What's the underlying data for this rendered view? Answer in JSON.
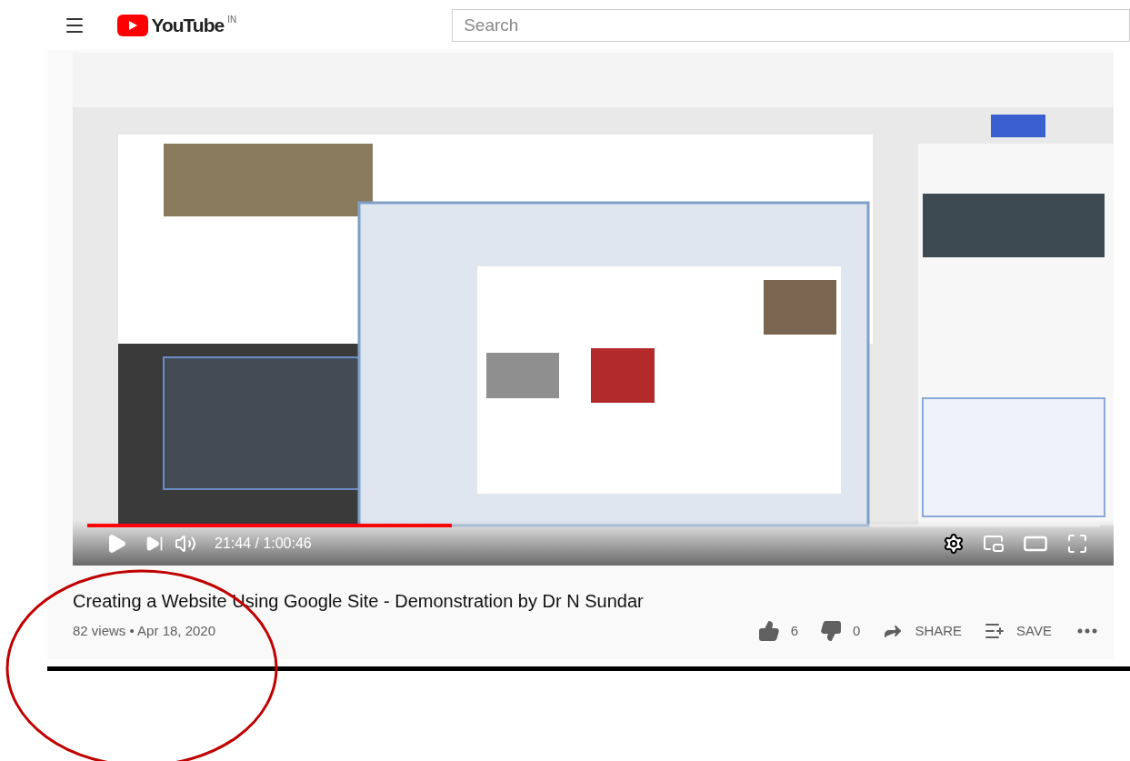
{
  "header": {
    "logo_text": "YouTube",
    "region": "IN",
    "search": {
      "placeholder": "Search"
    }
  },
  "player": {
    "progress": {
      "level": 0.36
    },
    "time": "21:44 / 1:00:46"
  },
  "video": {
    "title": "Creating a Website Using Google Site - Demonstration by Dr N Sundar",
    "meta": "82 views • Apr 18, 2020",
    "likes": "6",
    "dislikes": "0",
    "actions": [
      {
        "kind": "share",
        "label": "SHARE"
      },
      {
        "kind": "save",
        "label": "SAVE"
      }
    ]
  }
}
